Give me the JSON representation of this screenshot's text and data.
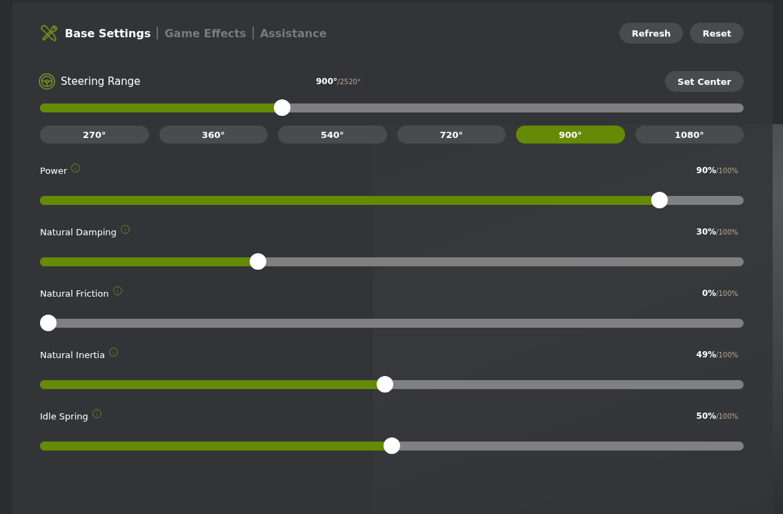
{
  "tabs": [
    {
      "label": "Base Settings",
      "selected": true
    },
    {
      "label": "Game Effects",
      "selected": false
    },
    {
      "label": "Assistance",
      "selected": false
    }
  ],
  "header_buttons": [
    "Refresh",
    "Reset"
  ],
  "steering_range": {
    "label": "Steering Range",
    "value": "900°",
    "max": "/2520°",
    "button": "Set Center",
    "level": 0.34,
    "presets": [
      {
        "label": "270°",
        "selected": false
      },
      {
        "label": "360°",
        "selected": false
      },
      {
        "label": "540°",
        "selected": false
      },
      {
        "label": "720°",
        "selected": false
      },
      {
        "label": "900°",
        "selected": true
      },
      {
        "label": "1080°",
        "selected": false
      }
    ]
  },
  "sliders": [
    {
      "label": "Power",
      "value": "90%",
      "max": "/100%",
      "level": 0.89
    },
    {
      "label": "Natural Damping",
      "value": "30%",
      "max": "/100%",
      "level": 0.305
    },
    {
      "label": "Natural Friction",
      "value": "0%",
      "max": "/100%",
      "level": 0.0
    },
    {
      "label": "Natural Inertia",
      "value": "49%",
      "max": "/100%",
      "level": 0.49
    },
    {
      "label": "Idle Spring",
      "value": "50%",
      "max": "/100%",
      "level": 0.5
    }
  ]
}
